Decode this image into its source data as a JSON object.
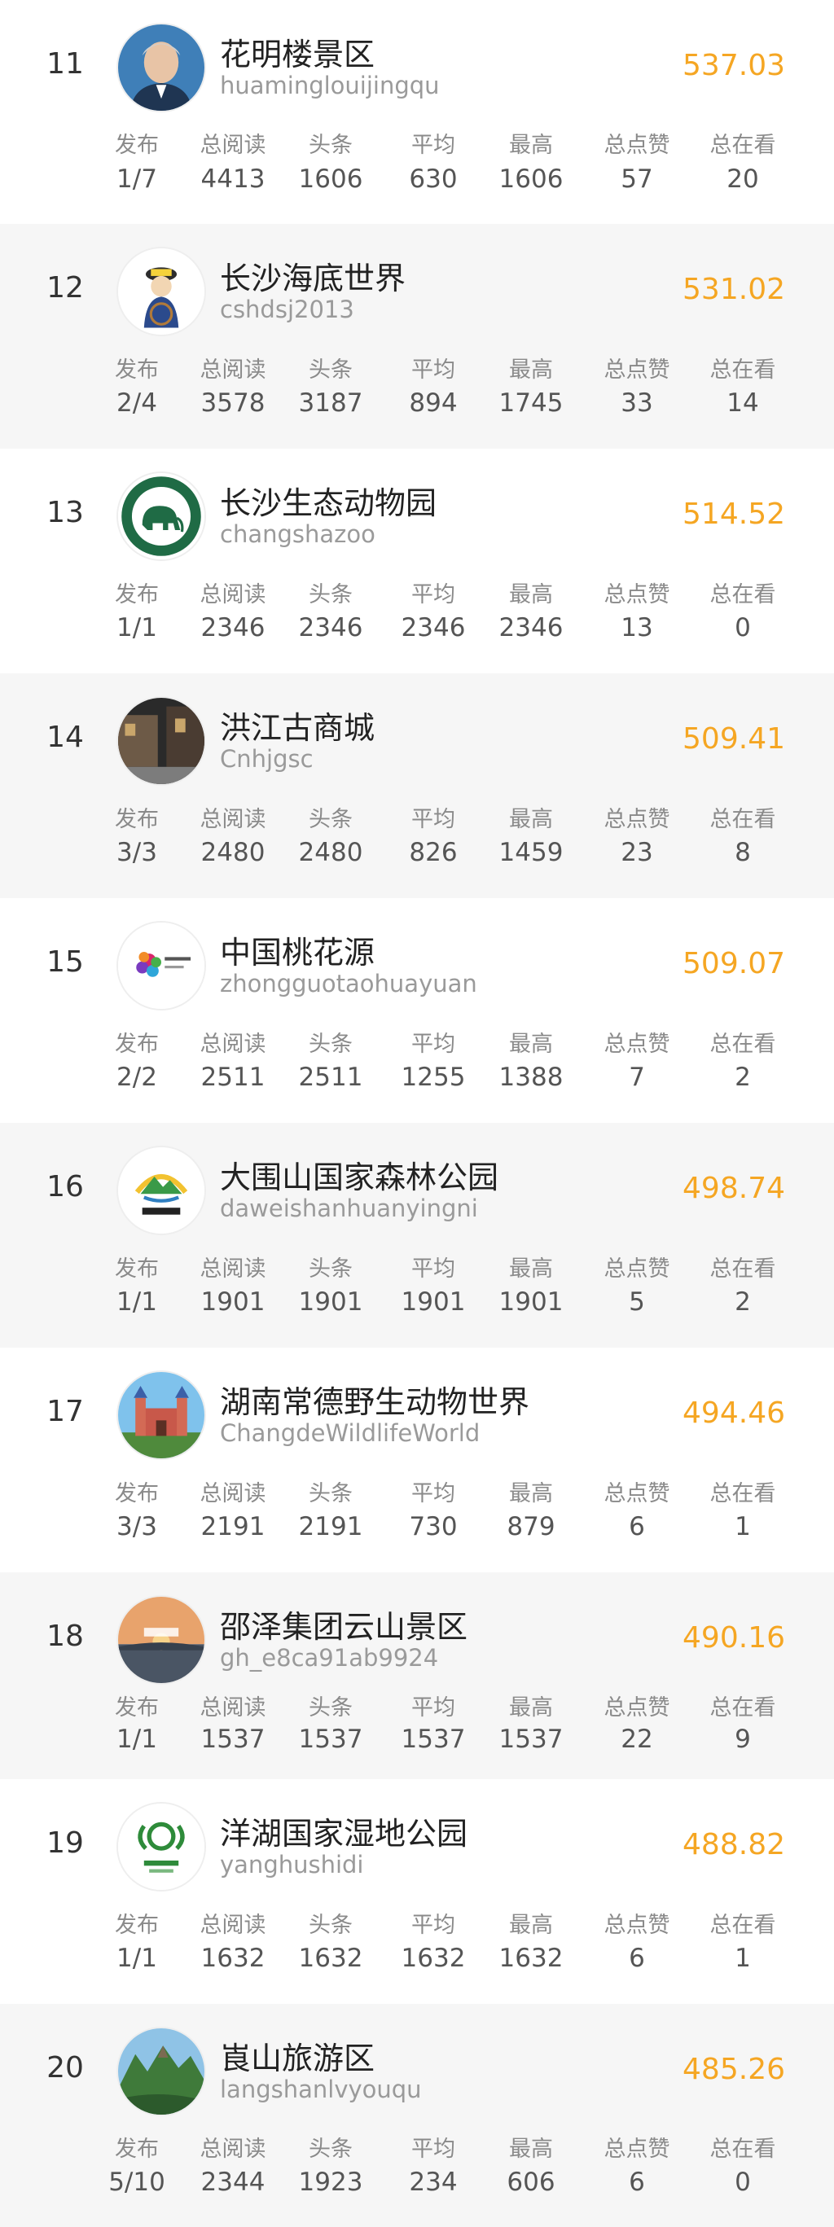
{
  "stat_labels": [
    "发布",
    "总阅读",
    "头条",
    "平均",
    "最高",
    "总点赞",
    "总在看"
  ],
  "colors": {
    "score": "#f5a623",
    "alt_row": "#f6f6f6"
  },
  "rows": [
    {
      "rank": "11",
      "name": "花明楼景区",
      "account": "huaminglouijingqu",
      "score": "537.03",
      "avatar_icon": "portrait-avatar-icon",
      "stats": [
        "1/7",
        "4413",
        "1606",
        "630",
        "1606",
        "57",
        "20"
      ]
    },
    {
      "rank": "12",
      "name": "长沙海底世界",
      "account": "cshdsj2013",
      "score": "531.02",
      "avatar_icon": "captain-mascot-avatar-icon",
      "stats": [
        "2/4",
        "3578",
        "3187",
        "894",
        "1745",
        "33",
        "14"
      ]
    },
    {
      "rank": "13",
      "name": "长沙生态动物园",
      "account": "changshazoo",
      "score": "514.52",
      "avatar_icon": "elephant-logo-avatar-icon",
      "stats": [
        "1/1",
        "2346",
        "2346",
        "2346",
        "2346",
        "13",
        "0"
      ]
    },
    {
      "rank": "14",
      "name": "洪江古商城",
      "account": "Cnhjgsc",
      "score": "509.41",
      "avatar_icon": "old-town-photo-avatar-icon",
      "stats": [
        "3/3",
        "2480",
        "2480",
        "826",
        "1459",
        "23",
        "8"
      ]
    },
    {
      "rank": "15",
      "name": "中国桃花源",
      "account": "zhongguotaohuayuan",
      "score": "509.07",
      "avatar_icon": "peach-blossom-logo-avatar-icon",
      "stats": [
        "2/2",
        "2511",
        "2511",
        "1255",
        "1388",
        "7",
        "2"
      ]
    },
    {
      "rank": "16",
      "name": "大围山国家森林公园",
      "account": "daweishanhuanyingni",
      "score": "498.74",
      "avatar_icon": "mountain-logo-avatar-icon",
      "stats": [
        "1/1",
        "1901",
        "1901",
        "1901",
        "1901",
        "5",
        "2"
      ]
    },
    {
      "rank": "17",
      "name": "湖南常德野生动物世界",
      "account": "ChangdeWildlifeWorld",
      "score": "494.46",
      "avatar_icon": "castle-photo-avatar-icon",
      "stats": [
        "3/3",
        "2191",
        "2191",
        "730",
        "879",
        "6",
        "1"
      ]
    },
    {
      "rank": "18",
      "name": "邵泽集团云山景区",
      "account": "gh_e8ca91ab9924",
      "score": "490.16",
      "avatar_icon": "sunset-lake-avatar-icon",
      "stats": [
        "1/1",
        "1537",
        "1537",
        "1537",
        "1537",
        "22",
        "9"
      ]
    },
    {
      "rank": "19",
      "name": "洋湖国家湿地公园",
      "account": "yanghushidi",
      "score": "488.82",
      "avatar_icon": "wetland-logo-avatar-icon",
      "stats": [
        "1/1",
        "1632",
        "1632",
        "1632",
        "1632",
        "6",
        "1"
      ]
    },
    {
      "rank": "20",
      "name": "崀山旅游区",
      "account": "langshanlvyouqu",
      "score": "485.26",
      "avatar_icon": "mountain-landscape-avatar-icon",
      "stats": [
        "5/10",
        "2344",
        "1923",
        "234",
        "606",
        "6",
        "0"
      ]
    }
  ]
}
